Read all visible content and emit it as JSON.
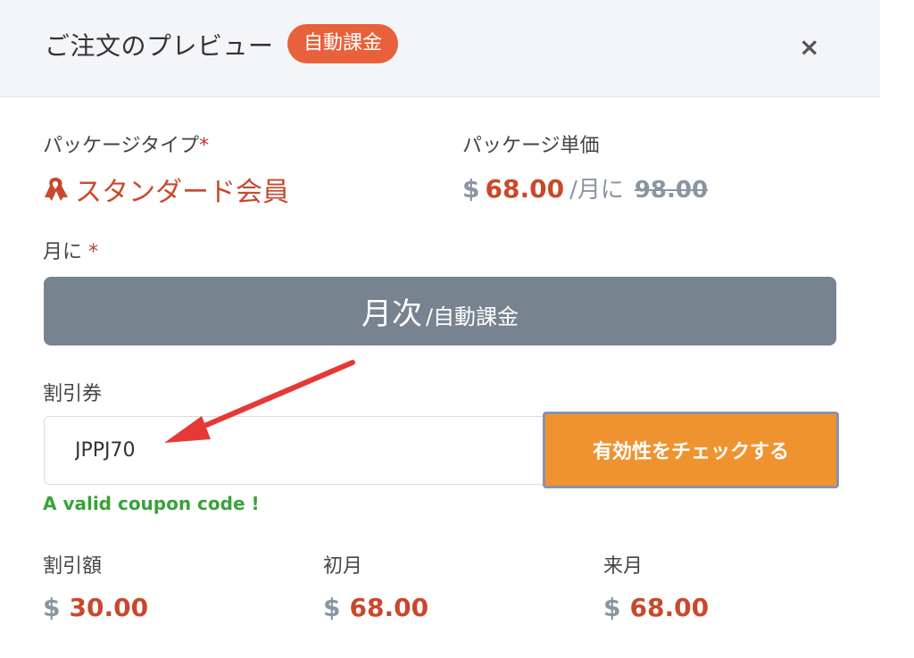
{
  "header": {
    "title": "ご注文のプレビュー",
    "badge": "自動課金",
    "close_icon": "×"
  },
  "package_type": {
    "label": "パッケージタイプ",
    "required_mark": "*",
    "value": "スタンダード会員",
    "icon": "ribbon-icon"
  },
  "package_price": {
    "label": "パッケージ単価",
    "currency": "$",
    "amount": "68.00",
    "per": "/月に",
    "original": "98.00"
  },
  "month": {
    "label": "月に",
    "required_mark": "*",
    "option_main": "月次",
    "option_sub": "/自動課金"
  },
  "coupon": {
    "label": "割引券",
    "value": "JPPJ70",
    "check_button": "有効性をチェックする",
    "valid_message": "A valid coupon code !"
  },
  "summary": [
    {
      "label": "割引額",
      "currency": "$",
      "value": "30.00"
    },
    {
      "label": "初月",
      "currency": "$",
      "value": "68.00"
    },
    {
      "label": "来月",
      "currency": "$",
      "value": "68.00"
    }
  ],
  "colors": {
    "accent": "#e8613a",
    "price": "#c9482c",
    "button_gray": "#788390",
    "check_orange": "#ef9330",
    "valid_green": "#3aa13a",
    "arrow_red": "#e53935"
  }
}
